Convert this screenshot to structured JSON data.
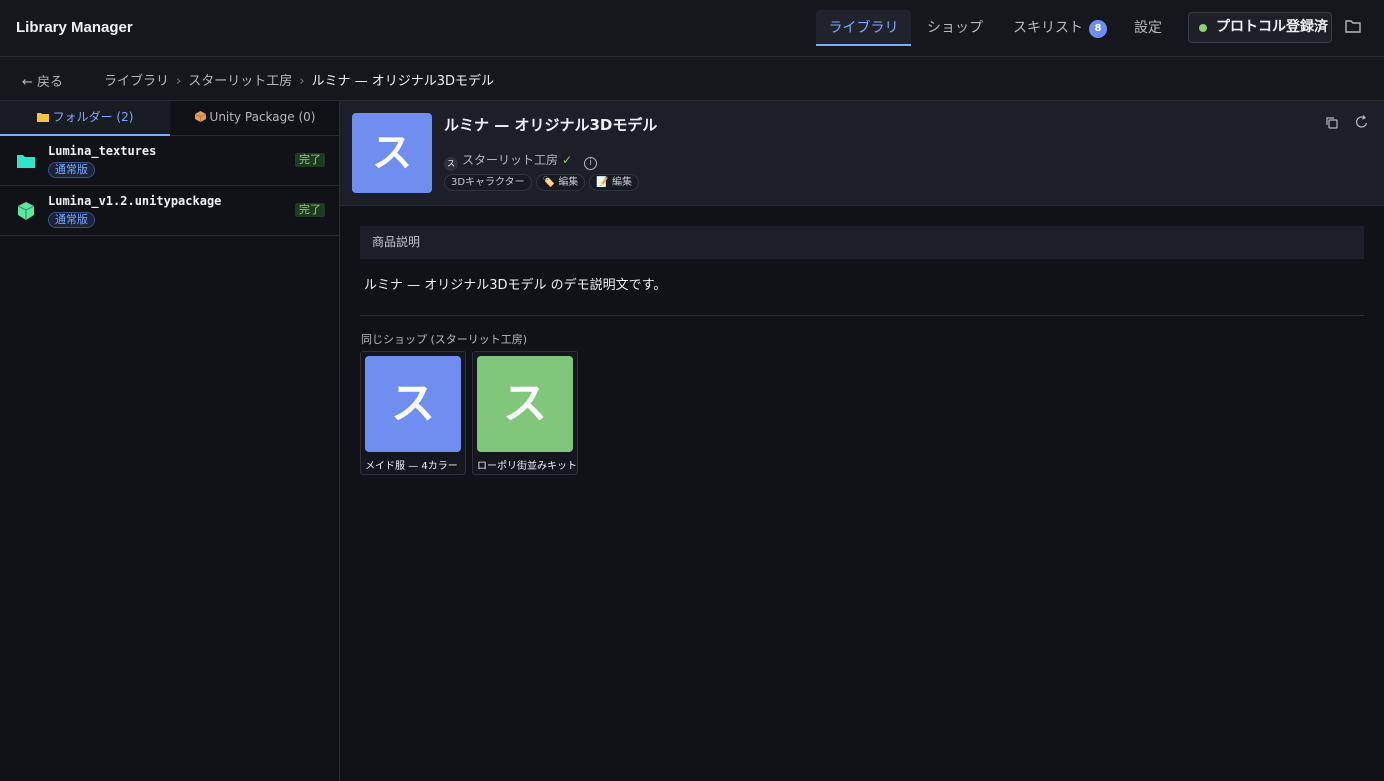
{
  "header": {
    "title": "Library Manager",
    "tabs": [
      {
        "label": "ライブラリ"
      },
      {
        "label": "ショップ"
      },
      {
        "label": "スキリスト",
        "badge": "8"
      },
      {
        "label": "設定"
      }
    ],
    "protocol_label": "プロトコル登録済"
  },
  "breadcrumb": {
    "back": "← 戻る",
    "items": [
      "ライブラリ",
      "スターリット工房",
      "ルミナ — オリジナル3Dモデル"
    ],
    "separator": "›"
  },
  "sidebar": {
    "tabs": [
      {
        "label": "フォルダー (2)"
      },
      {
        "label": "Unity Package (0)"
      }
    ],
    "files": [
      {
        "name": "Lumina_textures",
        "variant": "通常版",
        "status": "完了",
        "icon": "folder-icon"
      },
      {
        "name": "Lumina_v1.2.unitypackage",
        "variant": "通常版",
        "status": "完了",
        "icon": "package-icon"
      }
    ]
  },
  "product": {
    "thumb_letter": "ス",
    "title": "ルミナ — オリジナル3Dモデル",
    "shop_avatar": "ス",
    "shop_name": "スターリット工房",
    "verified": "✓",
    "info": "i",
    "tags": [
      "3Dキャラクター",
      "編集",
      "編集"
    ]
  },
  "description": {
    "heading": "商品説明",
    "body": "ルミナ — オリジナル3Dモデル のデモ説明文です。"
  },
  "same_shop": {
    "title": "同じショップ (スターリット工房)",
    "items": [
      {
        "letter": "ス",
        "label": "メイド服 — 4カラー",
        "color": "#6f8ef0"
      },
      {
        "letter": "ス",
        "label": "ローポリ街並みキット",
        "color": "#80c77b"
      }
    ]
  },
  "colors": {
    "accent": "#7fa8ff",
    "success": "#8ed16f"
  }
}
